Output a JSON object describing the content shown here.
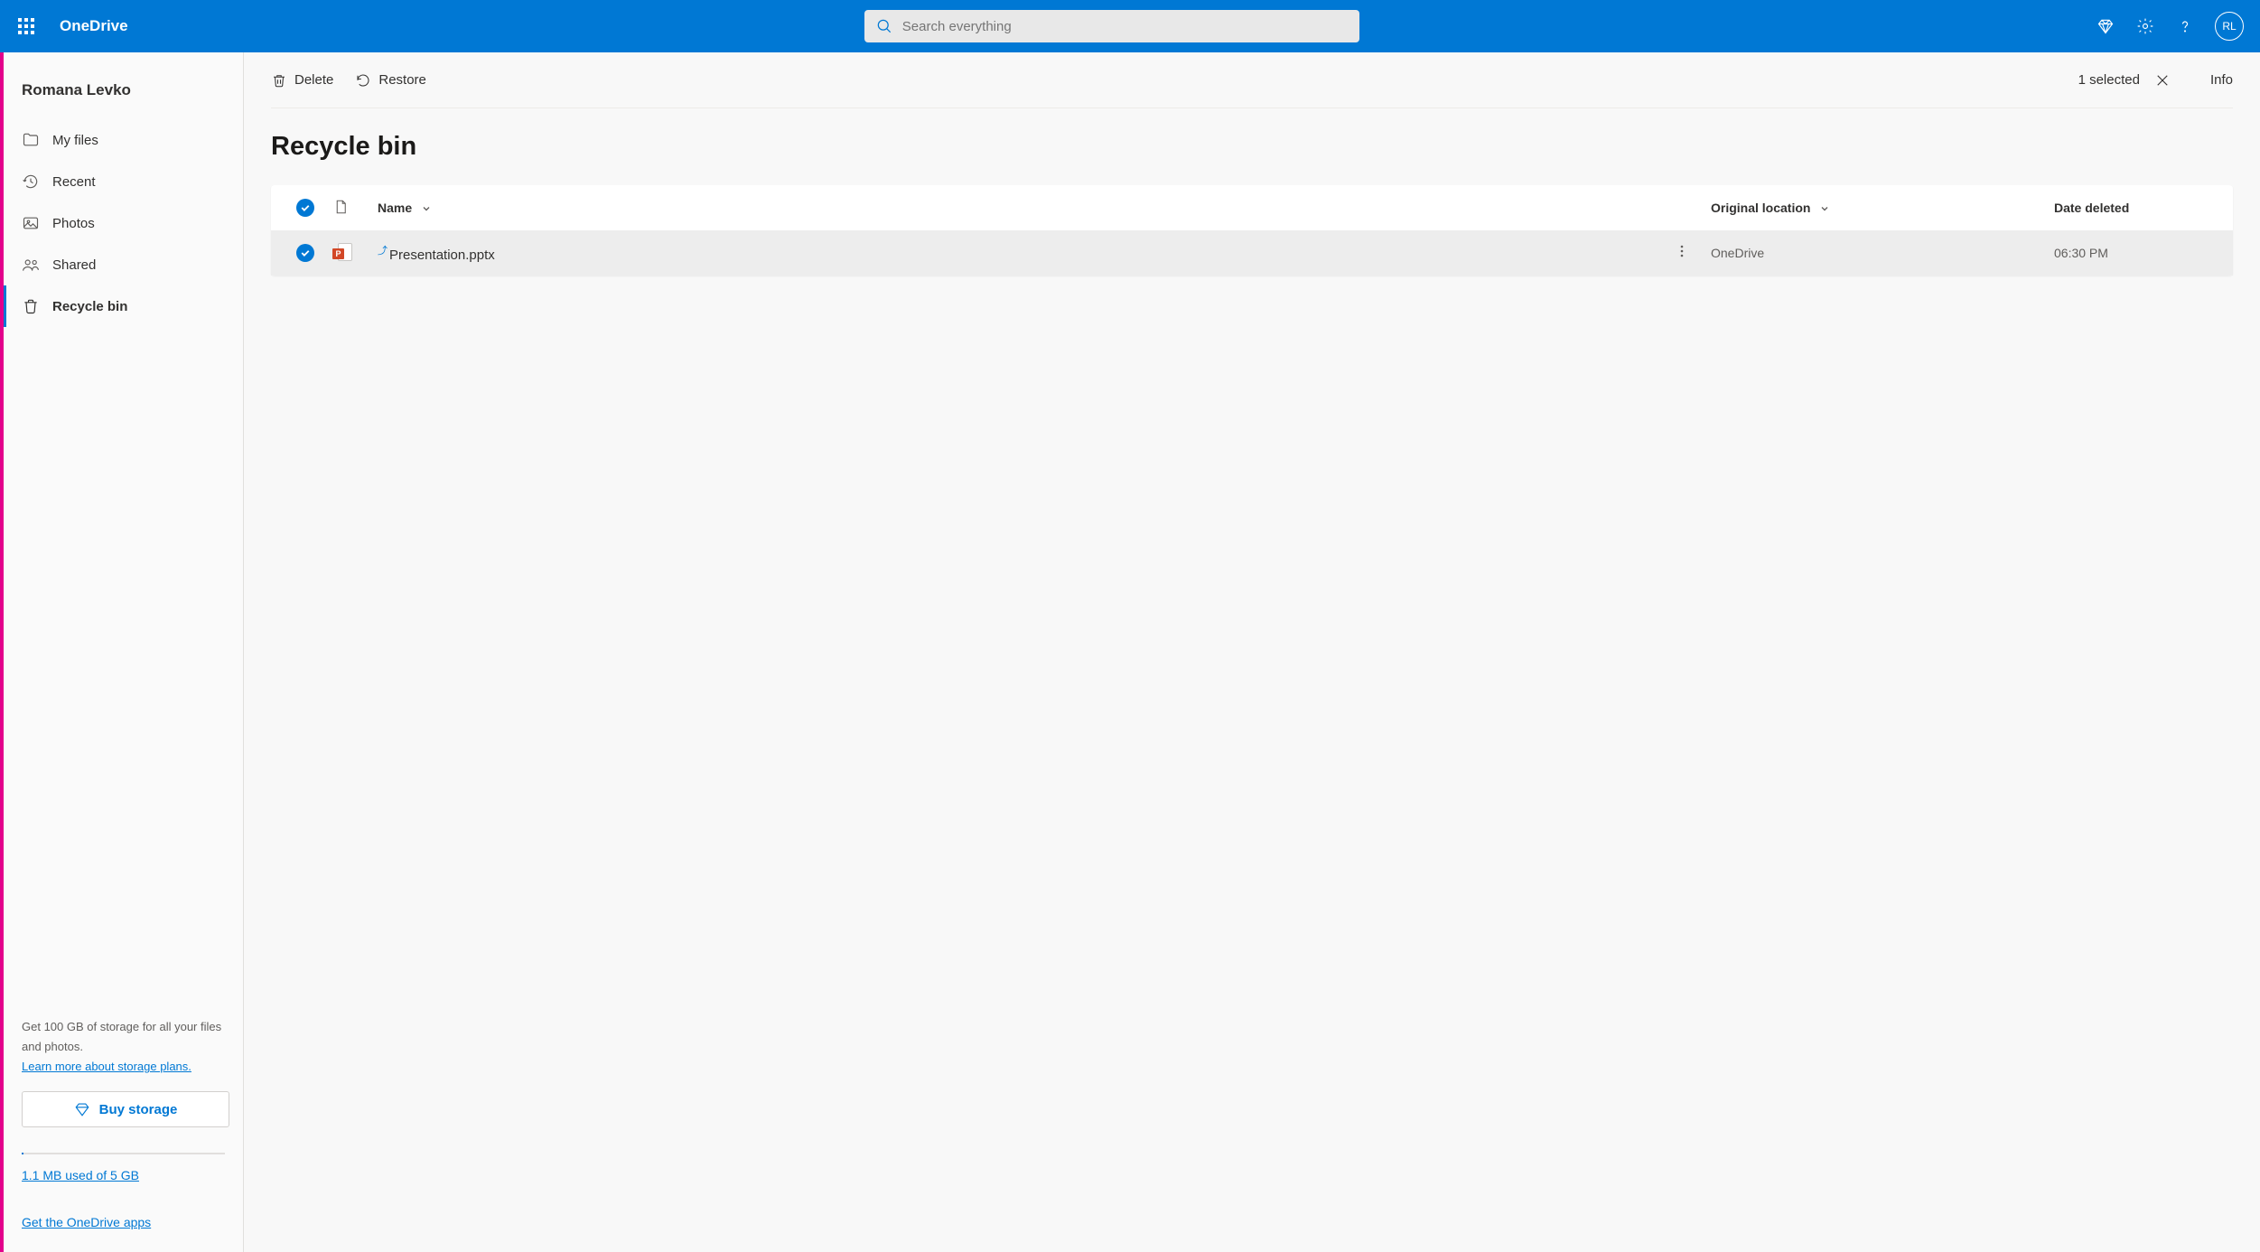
{
  "header": {
    "app_name": "OneDrive",
    "search_placeholder": "Search everything",
    "avatar_initials": "RL"
  },
  "sidebar": {
    "user_name": "Romana Levko",
    "items": [
      {
        "label": "My files",
        "icon": "folder-icon",
        "active": false
      },
      {
        "label": "Recent",
        "icon": "history-icon",
        "active": false
      },
      {
        "label": "Photos",
        "icon": "photo-icon",
        "active": false
      },
      {
        "label": "Shared",
        "icon": "people-icon",
        "active": false
      },
      {
        "label": "Recycle bin",
        "icon": "recycle-icon",
        "active": true
      }
    ],
    "storage_promo": "Get 100 GB of storage for all your files and photos.",
    "storage_link": "Learn more about storage plans.",
    "buy_button": "Buy storage",
    "storage_used": "1.1 MB used of 5 GB",
    "apps_link": "Get the OneDrive apps"
  },
  "commands": {
    "delete": "Delete",
    "restore": "Restore",
    "selected": "1 selected",
    "info": "Info"
  },
  "page": {
    "title": "Recycle bin"
  },
  "table": {
    "columns": {
      "name": "Name",
      "location": "Original location",
      "date": "Date deleted"
    },
    "rows": [
      {
        "name": "Presentation.pptx",
        "location": "OneDrive",
        "date": "06:30 PM",
        "selected": true,
        "icon": "pptx"
      }
    ]
  }
}
